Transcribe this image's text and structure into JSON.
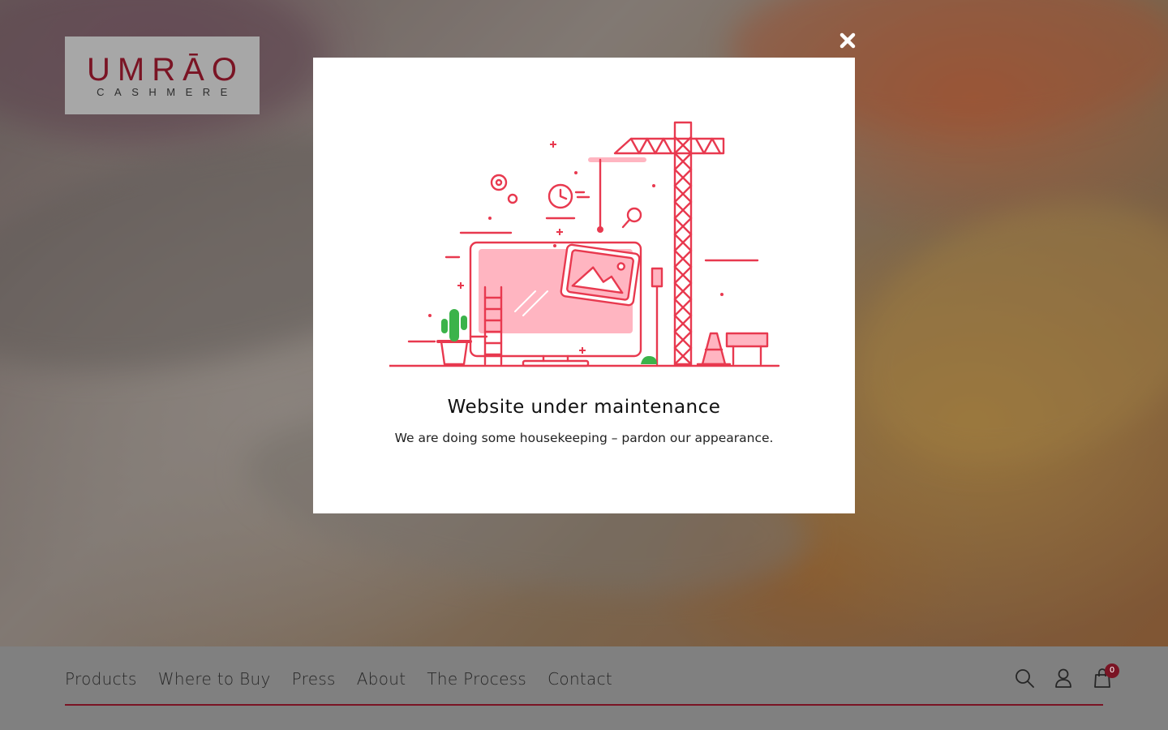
{
  "brand": {
    "logo_main": "UMRĀO",
    "logo_sub": "CASHMERE"
  },
  "modal": {
    "title": "Website under maintenance",
    "message": "We are doing some housekeeping – pardon our appearance."
  },
  "nav": {
    "items": [
      {
        "label": "Products"
      },
      {
        "label": "Where to Buy"
      },
      {
        "label": "Press"
      },
      {
        "label": "About"
      },
      {
        "label": "The Process"
      },
      {
        "label": "Contact"
      }
    ],
    "icons": [
      "search-icon",
      "user-icon",
      "cart-icon"
    ],
    "cart_count": "0"
  },
  "colors": {
    "brand": "#7a1424",
    "illustration_red": "#e8394f",
    "illustration_pink": "#ffb5c1",
    "cactus_green": "#3bb34a"
  }
}
